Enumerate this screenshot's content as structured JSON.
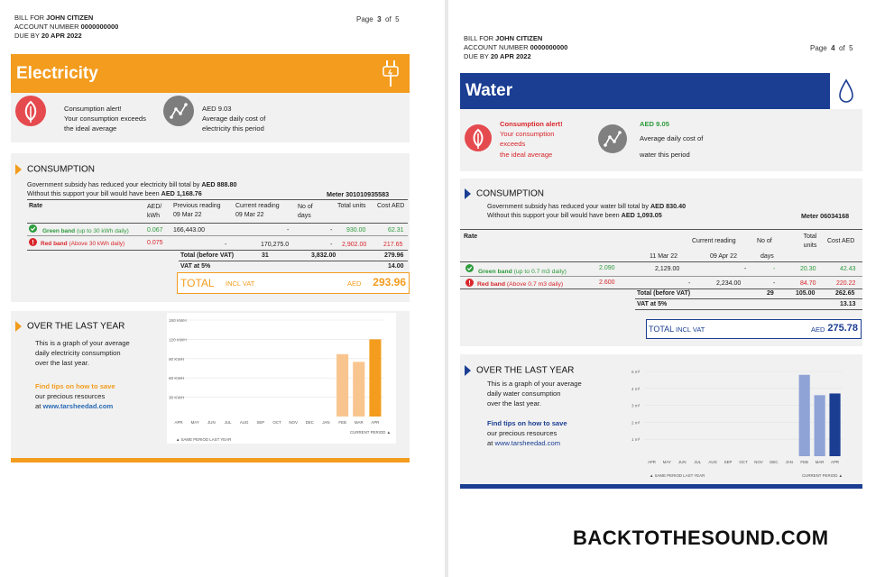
{
  "electricity": {
    "header": {
      "bill_for_label": "BILL FOR",
      "name": "JOHN CITIZEN",
      "account_label": "ACCOUNT NUMBER",
      "account": "0000000000",
      "due_label": "DUE BY",
      "due": "20 APR 2022"
    },
    "page": {
      "label": "Page",
      "current": "3",
      "of": "of",
      "total": "5"
    },
    "title": "Electricity",
    "alert": {
      "title": "Consumption alert!",
      "line1": "Your consumption exceeds",
      "line2": "the ideal average"
    },
    "avg": {
      "amount": "AED 9.03",
      "line1": "Average daily cost of",
      "line2": "electricity this period"
    },
    "consumption": {
      "title": "CONSUMPTION",
      "subsidy_text": "Government subsidy has reduced your electricity bill total by",
      "subsidy_amount": "AED 888.80",
      "without_text": "Without this support your bill would have been",
      "without_amount": "AED 1,168.76",
      "meter": "Meter 301010935583",
      "headers": {
        "rate": "Rate",
        "aed_kwh": "AED/ kWh",
        "prev": "Previous reading",
        "prev_date": "09 Mar 22",
        "curr": "Current reading",
        "curr_date": "09 Mar 22",
        "days": "No of days",
        "units": "Total units",
        "cost": "Cost AED"
      },
      "green": {
        "label": "Green band",
        "note": "(up to 30 kWh daily)",
        "rate": "0.067",
        "prev": "166,443.00",
        "curr": "-",
        "days": "-",
        "units": "930.00",
        "cost": "62.31"
      },
      "red": {
        "label": "Red band",
        "note": "(Above 30 kWh daily)",
        "rate": "0.075",
        "prev": "-",
        "curr": "170,275.0",
        "days": "-",
        "units": "2,902.00",
        "cost": "217.65"
      },
      "total_before": {
        "label": "Total (before VAT)",
        "days": "31",
        "units": "3,832.00",
        "cost": "279.96"
      },
      "vat": {
        "label": "VAT at 5%",
        "cost": "14.00"
      },
      "total": {
        "label": "TOTAL",
        "incl": "INCL VAT",
        "cur": "AED",
        "amount": "293.96"
      }
    },
    "year": {
      "title": "OVER THE LAST YEAR",
      "line1": "This is a graph of your average",
      "line2": "daily electricity consumption",
      "line3": "over the last year.",
      "tip1": "Find tips on how to save",
      "tip2": "our precious resources",
      "tip3_pre": "at",
      "tip3_link": "www.tarsheedad.com"
    },
    "chart_data": {
      "type": "bar",
      "categories": [
        "APR",
        "MAY",
        "JUN",
        "JUL",
        "AUG",
        "SEP",
        "OCT",
        "NOV",
        "DEC",
        "JAN",
        "FEB",
        "MAR",
        "APR"
      ],
      "values": [
        0,
        0,
        0,
        0,
        0,
        0,
        0,
        0,
        0,
        0,
        97,
        85,
        120
      ],
      "ytick_labels": [
        "150 KWH",
        "120 KWH",
        "90 KWH",
        "60 KWH",
        "30 KWH"
      ],
      "ytick_values": [
        150,
        120,
        90,
        60,
        30
      ],
      "ylim": [
        0,
        150
      ],
      "legend_same": "SAME PERIOD LAST YEAR",
      "legend_current": "CURRENT PERIOD",
      "colors": {
        "light": "#f9c58e",
        "current": "#f39c1e"
      }
    }
  },
  "water": {
    "header": {
      "bill_for_label": "BILL FOR",
      "name": "JOHN CITIZEN",
      "account_label": "ACCOUNT NUMBER",
      "account": "0000000000",
      "due_label": "DUE BY",
      "due": "20 APR 2022"
    },
    "page": {
      "label": "Page",
      "current": "4",
      "of": "of",
      "total": "5"
    },
    "title": "Water",
    "alert": {
      "title": "Consumption alert!",
      "line1": "Your consumption",
      "line2": "exceeds",
      "line3": "the ideal average"
    },
    "avg": {
      "amount": "AED 9.05",
      "line1": "Average daily cost of",
      "line2": "water this period"
    },
    "consumption": {
      "title": "CONSUMPTION",
      "subsidy_text": "Government subsidy has reduced your water bill total by",
      "subsidy_amount": "AED 830.40",
      "without_text": "Without this support your bill would have been",
      "without_amount": "AED 1,093.05",
      "meter": "Meter 06034168",
      "headers": {
        "rate": "Rate",
        "curr": "Current reading",
        "days": "No of",
        "days2": "days",
        "units": "Total units",
        "cost": "Cost AED",
        "prev_date": "11 Mar 22",
        "curr_date": "09 Apr 22"
      },
      "green": {
        "label": "Green band",
        "note": "(up to 0.7 m3 daily)",
        "rate": "2.090",
        "prev": "2,129.00",
        "curr": "-",
        "days": "-",
        "units": "20.30",
        "cost": "42.43"
      },
      "red": {
        "label": "Red band",
        "note": "(Above 0.7 m3 daily)",
        "rate": "2.600",
        "prev": "-",
        "curr": "2,234.00",
        "days": "-",
        "units": "84.70",
        "cost": "220.22"
      },
      "total_before": {
        "label": "Total (before VAT)",
        "days": "29",
        "units": "105.00",
        "cost": "262.65"
      },
      "vat": {
        "label": "VAT at 5%",
        "cost": "13.13"
      },
      "total": {
        "label": "TOTAL",
        "incl": "INCL VAT",
        "cur": "AED",
        "amount": "275.78"
      }
    },
    "year": {
      "title": "OVER THE LAST YEAR",
      "line1": "This is a graph of your average",
      "line2": "daily water consumption",
      "line3": "over the last year.",
      "tip1": "Find tips on how to save",
      "tip2": "our precious resources",
      "tip3_pre": "at",
      "tip3_link": "www.tarsheedad.com"
    },
    "chart_data": {
      "type": "bar",
      "categories": [
        "APR",
        "MAY",
        "JUN",
        "JUL",
        "AUG",
        "SEP",
        "OCT",
        "NOV",
        "DEC",
        "JAN",
        "FEB",
        "MAR",
        "APR"
      ],
      "values": [
        0,
        0,
        0,
        0,
        0,
        0,
        0,
        0,
        0,
        0,
        4.8,
        3.6,
        3.7
      ],
      "ytick_labels": [
        "5 m³",
        "4 m³",
        "3 m³",
        "2 m³",
        "1 m³"
      ],
      "ytick_values": [
        5,
        4,
        3,
        2,
        1
      ],
      "ylim": [
        0,
        5
      ],
      "legend_same": "SAME PERIOD LAST YEAR",
      "legend_current": "CURRENT PERIOD",
      "colors": {
        "light": "#8fa3d6",
        "current": "#1b3e93"
      }
    }
  },
  "watermark": "BACKTOTHESOUND.COM",
  "colors": {
    "electric": "#f39c1e",
    "water": "#1b3e93",
    "red": "#d9262b",
    "green": "#2e9b3c",
    "grey_icon": "#808080"
  }
}
